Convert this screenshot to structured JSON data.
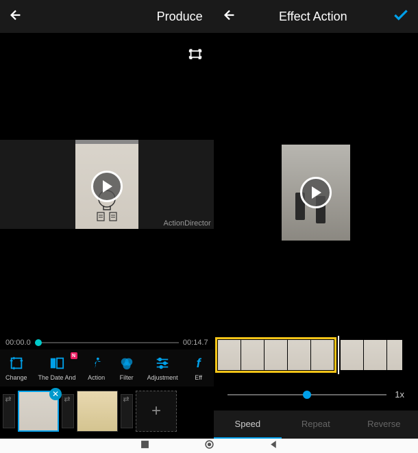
{
  "left": {
    "header": {
      "title": "Produce"
    },
    "watermark": "ActionDirector",
    "timeline": {
      "start": "00:00.0",
      "end": "00:14.7"
    },
    "tools": [
      {
        "id": "change",
        "label": "Change"
      },
      {
        "id": "title",
        "label": "The Date And",
        "badge": "N"
      },
      {
        "id": "action",
        "label": "Action"
      },
      {
        "id": "filter",
        "label": "Filter"
      },
      {
        "id": "adjustment",
        "label": "Adjustment"
      },
      {
        "id": "effect",
        "label": "Eff"
      }
    ],
    "add_label": "+"
  },
  "right": {
    "header": {
      "title": "Effect Action"
    },
    "speed": {
      "value": "1x"
    },
    "tabs": [
      {
        "id": "speed",
        "label": "Speed",
        "active": true
      },
      {
        "id": "repeat",
        "label": "Repeat",
        "active": false
      },
      {
        "id": "reverse",
        "label": "Reverse",
        "active": false
      }
    ]
  }
}
